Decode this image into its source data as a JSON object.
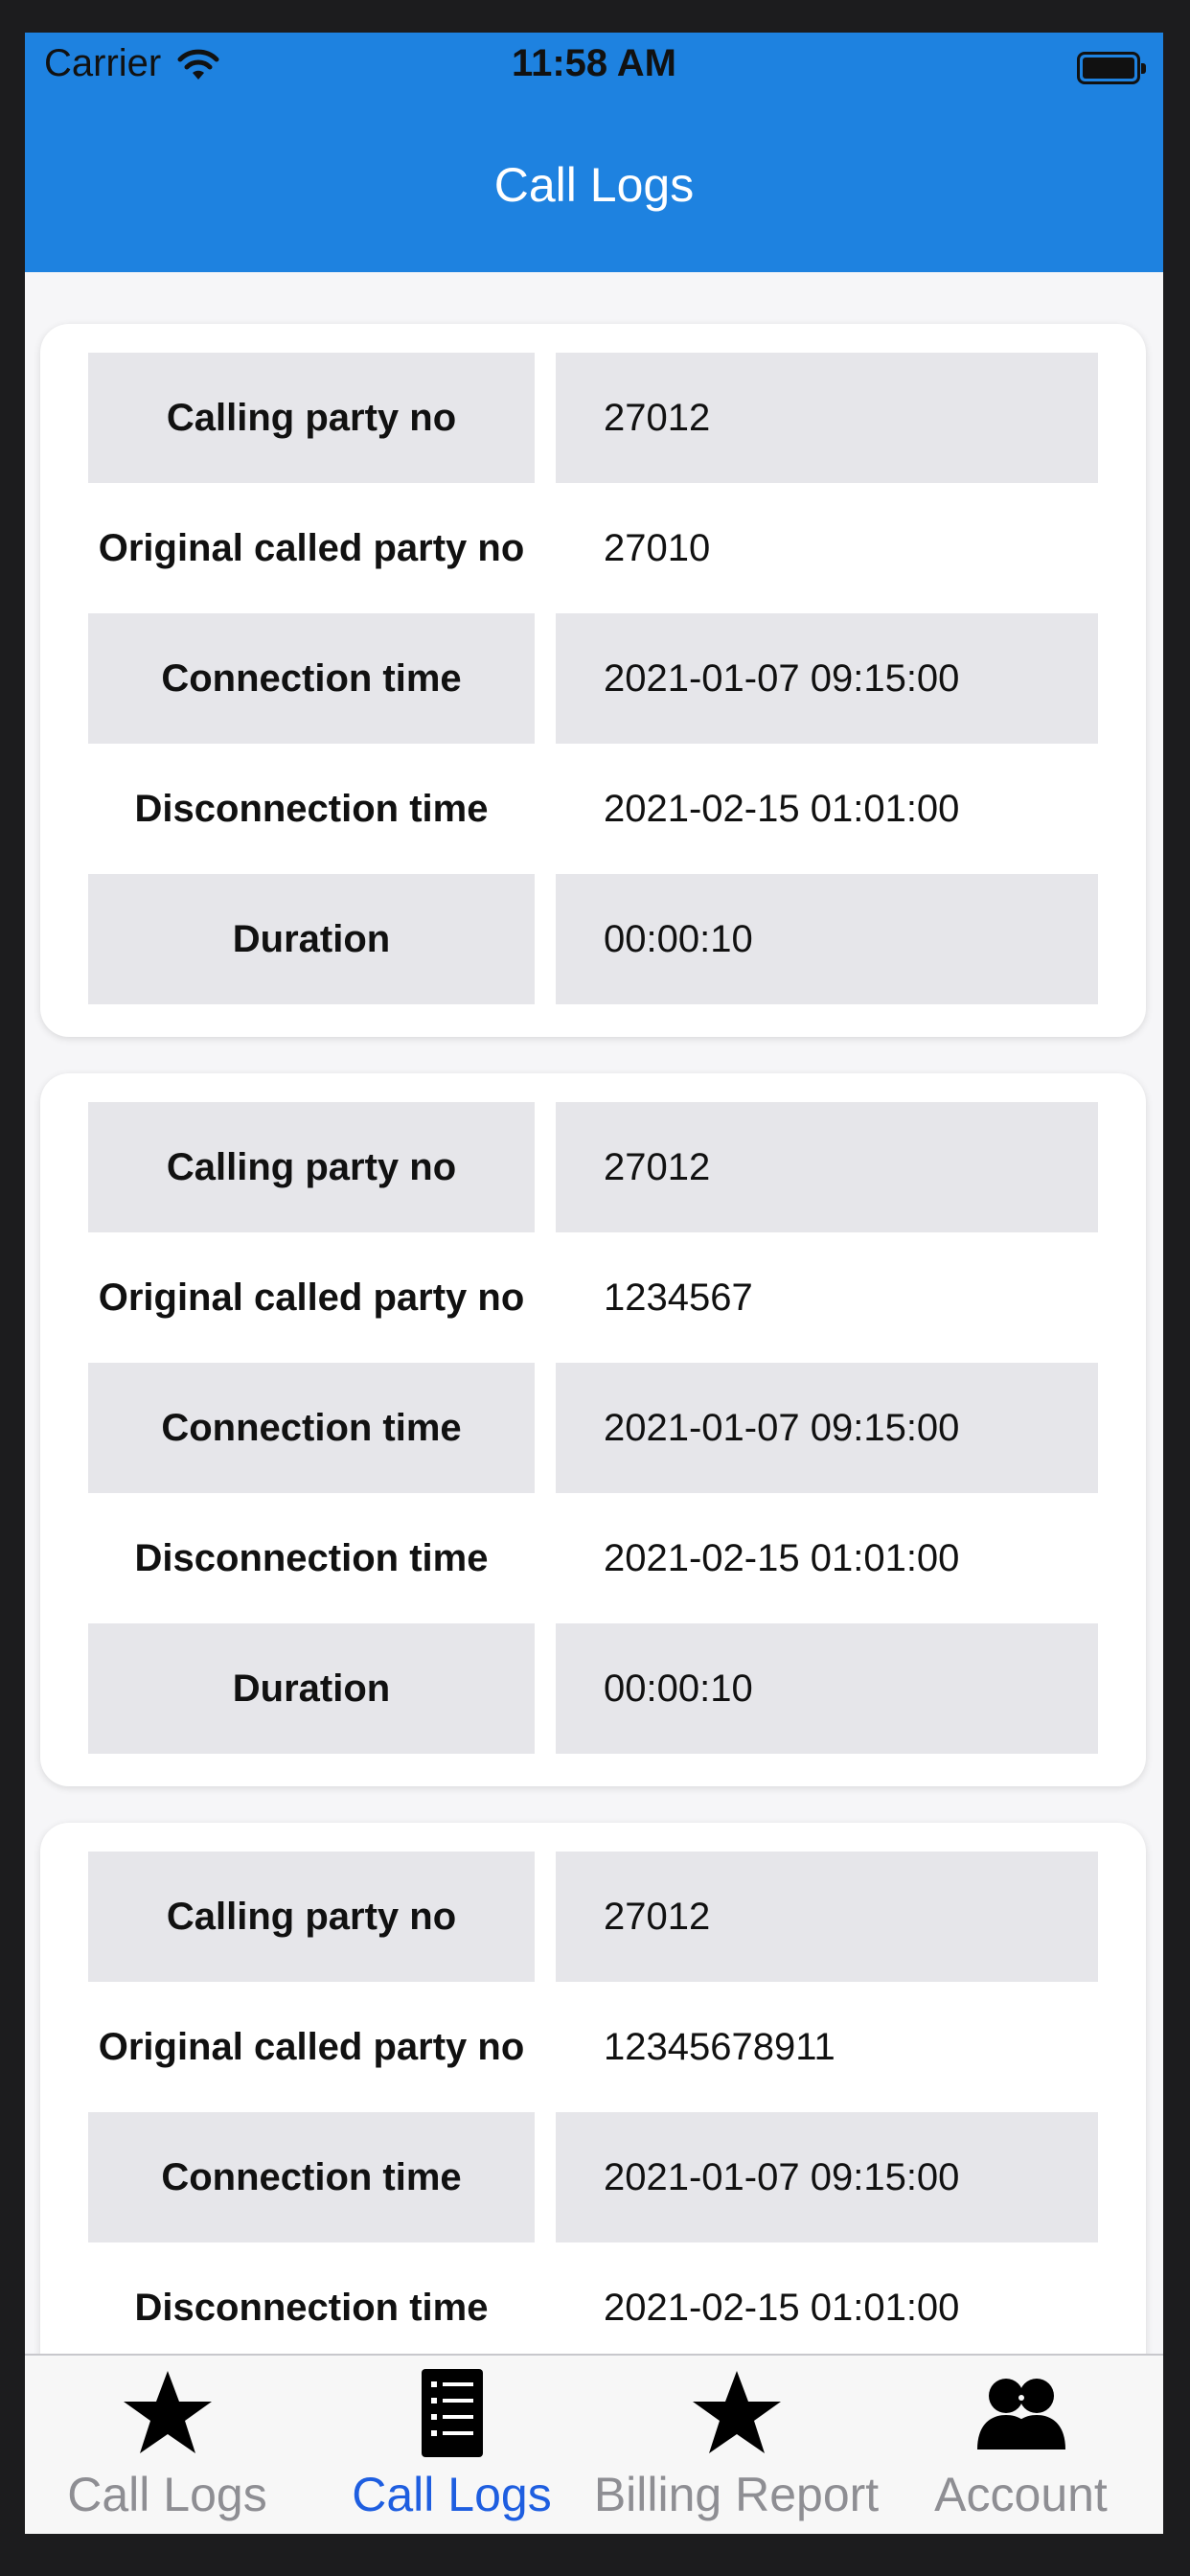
{
  "status_bar": {
    "carrier": "Carrier",
    "time": "11:58 AM"
  },
  "header": {
    "title": "Call Logs"
  },
  "cards": [
    {
      "rows": [
        {
          "label": "Calling party no",
          "value": "27012"
        },
        {
          "label": "Original called party no",
          "value": "27010"
        },
        {
          "label": "Connection time",
          "value": "2021-01-07 09:15:00"
        },
        {
          "label": "Disconnection time",
          "value": "2021-02-15 01:01:00"
        },
        {
          "label": "Duration",
          "value": "00:00:10"
        }
      ]
    },
    {
      "rows": [
        {
          "label": "Calling party no",
          "value": "27012"
        },
        {
          "label": "Original called party no",
          "value": "1234567"
        },
        {
          "label": "Connection time",
          "value": "2021-01-07 09:15:00"
        },
        {
          "label": "Disconnection time",
          "value": "2021-02-15 01:01:00"
        },
        {
          "label": "Duration",
          "value": "00:00:10"
        }
      ]
    },
    {
      "rows": [
        {
          "label": "Calling party no",
          "value": "27012"
        },
        {
          "label": "Original called party no",
          "value": "12345678911"
        },
        {
          "label": "Connection time",
          "value": "2021-01-07 09:15:00"
        },
        {
          "label": "Disconnection time",
          "value": "2021-02-15 01:01:00"
        }
      ]
    }
  ],
  "tabs": [
    {
      "label": "Call Logs",
      "icon": "star-icon",
      "active": false
    },
    {
      "label": "Call Logs",
      "icon": "list-icon",
      "active": true
    },
    {
      "label": "Billing Report",
      "icon": "star-icon",
      "active": false
    },
    {
      "label": "Account",
      "icon": "people-icon",
      "active": false
    }
  ],
  "colors": {
    "header": "#1e82e0",
    "active_tab": "#1e5ee0",
    "inactive_tab": "#8e8e93",
    "row_shade": "#e6e6ea"
  }
}
